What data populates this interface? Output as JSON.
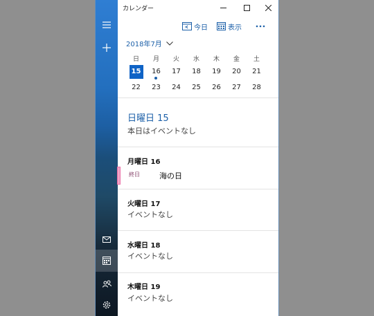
{
  "window": {
    "title": "カレンダー"
  },
  "commands": {
    "today_label": "今日",
    "view_label": "表示"
  },
  "calendar": {
    "month_label": "2018年7月",
    "weekdays": [
      "日",
      "月",
      "火",
      "水",
      "木",
      "金",
      "土"
    ],
    "week1": [
      "15",
      "16",
      "17",
      "18",
      "19",
      "20",
      "21"
    ],
    "week2": [
      "22",
      "23",
      "24",
      "25",
      "26",
      "27",
      "28"
    ],
    "selected_day": "15"
  },
  "agenda": {
    "day1": {
      "heading": "日曜日 15",
      "text": "本日はイベントなし"
    },
    "day2": {
      "heading": "月曜日 16",
      "event_time": "終日",
      "event_title": "海の日"
    },
    "day3": {
      "heading": "火曜日 17",
      "text": "イベントなし"
    },
    "day4": {
      "heading": "水曜日 18",
      "text": "イベントなし"
    },
    "day5": {
      "heading": "木曜日 19",
      "text": "イベントなし"
    }
  },
  "colors": {
    "accent": "#0f63c6",
    "event": "#ea6fa6"
  },
  "icons": [
    "hamburger-icon",
    "plus-icon",
    "mail-icon",
    "calendar-icon",
    "people-icon",
    "settings-icon",
    "minimize-icon",
    "maximize-icon",
    "close-icon",
    "today-icon",
    "view-icon",
    "more-icon",
    "chevron-down-icon"
  ]
}
